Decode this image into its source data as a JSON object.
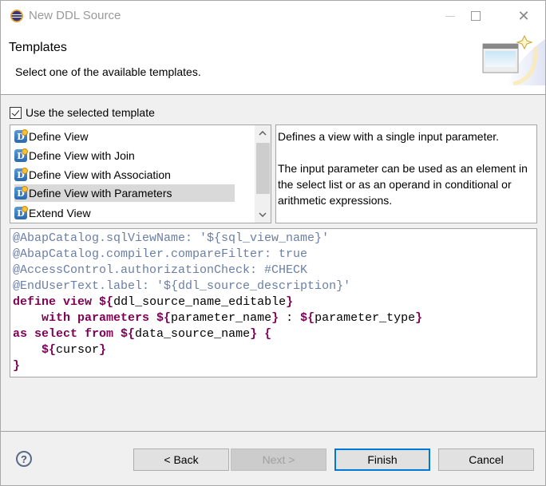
{
  "window": {
    "title": "New DDL Source",
    "controls": {
      "minimize": "—",
      "maximize": "☐",
      "close": "✕"
    }
  },
  "header": {
    "title": "Templates",
    "subtitle": "Select one of the available templates."
  },
  "use_template": {
    "label": "Use the selected template",
    "checked": true
  },
  "templates": {
    "icon_letter": "D",
    "items": [
      {
        "label": "Define View",
        "selected": false
      },
      {
        "label": "Define View with Join",
        "selected": false
      },
      {
        "label": "Define View with Association",
        "selected": false
      },
      {
        "label": "Define View with Parameters",
        "selected": true
      },
      {
        "label": "Extend View",
        "selected": false
      }
    ],
    "scroll_up": "⌃",
    "scroll_down": "⌄"
  },
  "description": {
    "paragraph1": "Defines a view with a single input parameter.",
    "paragraph2": "The input parameter can be used as an element in the select list or as an operand in conditional or arithmetic expressions."
  },
  "code": {
    "lines": [
      [
        {
          "t": "@AbapCatalog.sqlViewName: '${sql_view_name}'",
          "c": "ann"
        }
      ],
      [
        {
          "t": "@AbapCatalog.compiler.compareFilter: true",
          "c": "ann"
        }
      ],
      [
        {
          "t": "@AccessControl.authorizationCheck: #CHECK",
          "c": "ann"
        }
      ],
      [
        {
          "t": "@EndUserText.label: '${ddl_source_description}'",
          "c": "ann"
        }
      ],
      [
        {
          "t": "define view ",
          "c": "kw"
        },
        {
          "t": "$",
          "c": "kw"
        },
        {
          "t": "{",
          "c": "kw"
        },
        {
          "t": "ddl_source_name_editable",
          "c": "txt"
        },
        {
          "t": "}",
          "c": "kw"
        }
      ],
      [
        {
          "t": "    with parameters ",
          "c": "kw"
        },
        {
          "t": "${",
          "c": "kw"
        },
        {
          "t": "parameter_name",
          "c": "txt"
        },
        {
          "t": "}",
          "c": "kw"
        },
        {
          "t": " : ",
          "c": "txt"
        },
        {
          "t": "${",
          "c": "kw"
        },
        {
          "t": "parameter_type",
          "c": "txt"
        },
        {
          "t": "}",
          "c": "kw"
        }
      ],
      [
        {
          "t": "as select from ",
          "c": "kw"
        },
        {
          "t": "${",
          "c": "kw"
        },
        {
          "t": "data_source_name",
          "c": "txt"
        },
        {
          "t": "}",
          "c": "kw"
        },
        {
          "t": " {",
          "c": "kw"
        }
      ],
      [
        {
          "t": "    ${",
          "c": "kw"
        },
        {
          "t": "cursor",
          "c": "txt"
        },
        {
          "t": "}",
          "c": "kw"
        }
      ],
      [
        {
          "t": "}",
          "c": "kw"
        }
      ]
    ]
  },
  "footer": {
    "help": "?",
    "back": "< Back",
    "next": "Next >",
    "finish": "Finish",
    "cancel": "Cancel"
  }
}
